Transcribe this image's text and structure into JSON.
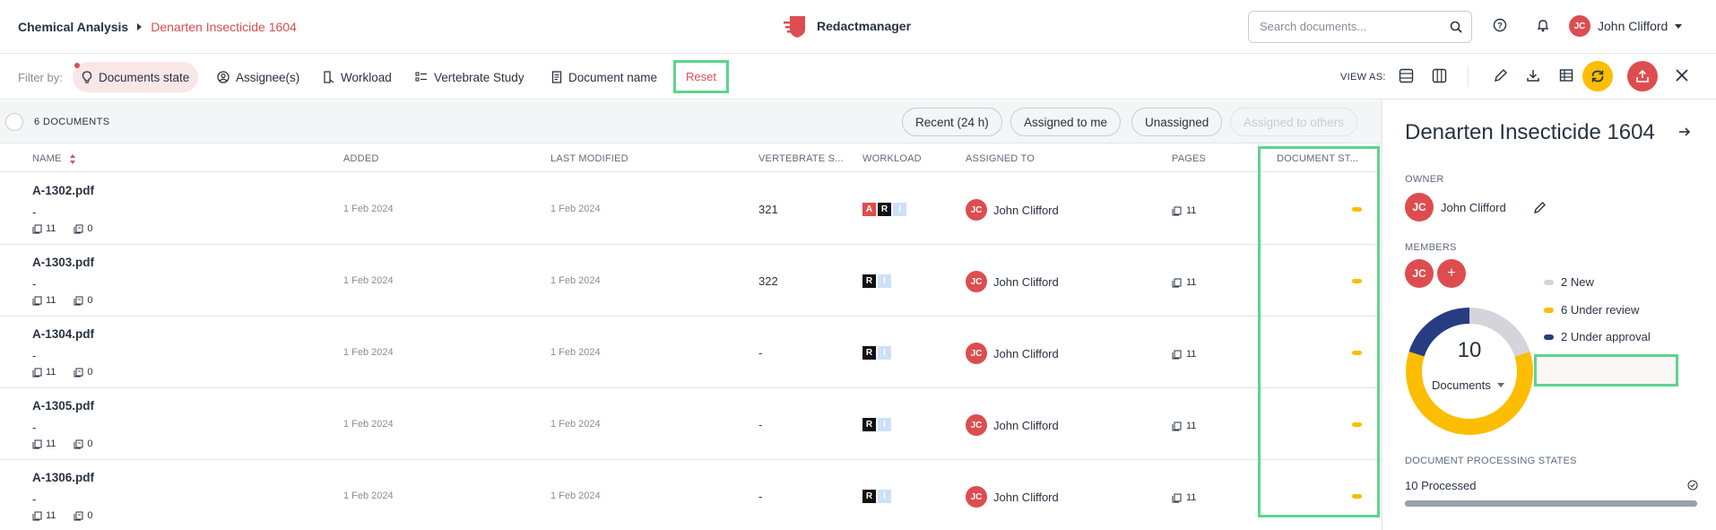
{
  "breadcrumb": {
    "parent": "Chemical Analysis",
    "current": "Denarten Insecticide 1604"
  },
  "app": {
    "name": "Redactmanager",
    "brand_color": "#dd4d50"
  },
  "search": {
    "placeholder": "Search documents..."
  },
  "user": {
    "initials": "JC",
    "name": "John Clifford"
  },
  "filters": {
    "label": "Filter by:",
    "items": [
      "Documents state",
      "Assignee(s)",
      "Workload",
      "Vertebrate Study",
      "Document name"
    ],
    "reset": "Reset"
  },
  "view": {
    "label": "VIEW AS:"
  },
  "list": {
    "count_label": "6 DOCUMENTS",
    "quick_filters": [
      "Recent (24 h)",
      "Assigned to me",
      "Unassigned",
      "Assigned to others"
    ],
    "columns": [
      "NAME",
      "ADDED",
      "LAST MODIFIED",
      "VERTEBRATE S...",
      "WORKLOAD",
      "ASSIGNED TO",
      "PAGES",
      "DOCUMENT ST..."
    ],
    "rows": [
      {
        "name": "A-1302.pdf",
        "dash": "-",
        "pages": "11",
        "annotations": "0",
        "added": "1 Feb 2024",
        "modified": "1 Feb 2024",
        "vertebrate": "321",
        "workload": [
          "A",
          "R",
          "I"
        ],
        "assignee_initials": "JC",
        "assignee": "John Clifford",
        "page_count": "11",
        "state_color": "#fdbd00"
      },
      {
        "name": "A-1303.pdf",
        "dash": "-",
        "pages": "11",
        "annotations": "0",
        "added": "1 Feb 2024",
        "modified": "1 Feb 2024",
        "vertebrate": "322",
        "workload": [
          "R",
          "I"
        ],
        "assignee_initials": "JC",
        "assignee": "John Clifford",
        "page_count": "11",
        "state_color": "#fdbd00"
      },
      {
        "name": "A-1304.pdf",
        "dash": "-",
        "pages": "11",
        "annotations": "0",
        "added": "1 Feb 2024",
        "modified": "1 Feb 2024",
        "vertebrate": "-",
        "workload": [
          "R",
          "I"
        ],
        "assignee_initials": "JC",
        "assignee": "John Clifford",
        "page_count": "11",
        "state_color": "#fdbd00"
      },
      {
        "name": "A-1305.pdf",
        "dash": "-",
        "pages": "11",
        "annotations": "0",
        "added": "1 Feb 2024",
        "modified": "1 Feb 2024",
        "vertebrate": "-",
        "workload": [
          "R",
          "I"
        ],
        "assignee_initials": "JC",
        "assignee": "John Clifford",
        "page_count": "11",
        "state_color": "#fdbd00"
      },
      {
        "name": "A-1306.pdf",
        "dash": "-",
        "pages": "11",
        "annotations": "0",
        "added": "1 Feb 2024",
        "modified": "1 Feb 2024",
        "vertebrate": "-",
        "workload": [
          "R",
          "I"
        ],
        "assignee_initials": "JC",
        "assignee": "John Clifford",
        "page_count": "11",
        "state_color": "#fdbd00"
      }
    ]
  },
  "panel": {
    "title": "Denarten Insecticide 1604",
    "owner_label": "OWNER",
    "owner_initials": "JC",
    "owner_name": "John Clifford",
    "members_label": "MEMBERS",
    "member_initials": "JC",
    "add_member": "+",
    "total": "10",
    "total_label": "Documents",
    "legend": [
      {
        "label": "2 New",
        "value": 2,
        "color": "#d3d5da"
      },
      {
        "label": "6 Under review",
        "value": 6,
        "color": "#fdbd00"
      },
      {
        "label": "2 Under approval",
        "value": 2,
        "color": "#283c82"
      }
    ],
    "processing_label": "DOCUMENT PROCESSING STATES",
    "processed": "10 Processed",
    "processed_fraction": 1.0
  }
}
